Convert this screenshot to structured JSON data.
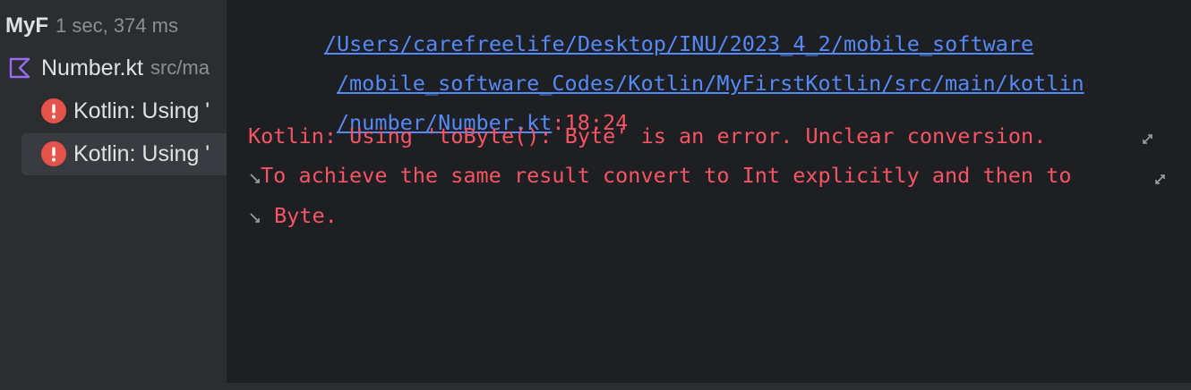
{
  "tree": {
    "run": {
      "name": "MyF",
      "time": "1 sec, 374 ms"
    },
    "file": {
      "name": "Number.kt",
      "path": "src/ma",
      "icon": "kotlin-file-icon"
    },
    "errors": [
      {
        "text": "Kotlin: Using '",
        "icon": "error-icon"
      },
      {
        "text": "Kotlin: Using '",
        "icon": "error-icon",
        "selected": true
      }
    ]
  },
  "message": {
    "path_line1": "/Users/carefreelife/Desktop/INU/2023_4_2/mobile_software",
    "path_line2": "/mobile_software_Codes/Kotlin/MyFirstKotlin/src/main/kotlin",
    "path_line3": "/number/Number.kt",
    "location": ":18:24",
    "error_line1": "Kotlin: Using 'toByte(): Byte' is an error. Unclear conversion.",
    "error_line2": "To achieve the same result convert to Int explicitly and then to",
    "error_line3": "Byte."
  },
  "colors": {
    "link": "#548af7",
    "error": "#f75464",
    "panel_bg": "#2b2d30",
    "editor_bg": "#1e1f22",
    "error_icon": "#e5534b",
    "kotlin_icon": "#9b6bf2"
  }
}
